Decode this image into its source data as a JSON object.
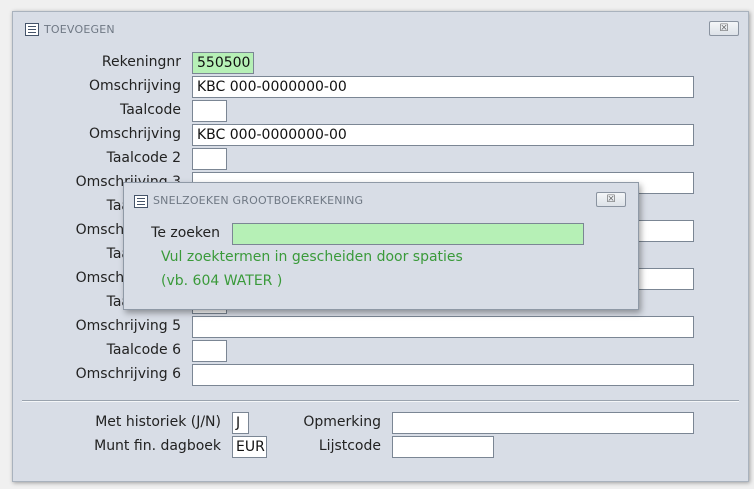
{
  "main_window": {
    "title": "TOEVOEGEN",
    "close_label": "☒",
    "fields": {
      "rekeningnr": {
        "label": "Rekeningnr",
        "value": "550500"
      },
      "omschrijving1": {
        "label": "Omschrijving",
        "value": "KBC 000-0000000-00"
      },
      "taalcode1": {
        "label": "Taalcode",
        "value": ""
      },
      "omschrijving2": {
        "label": "Omschrijving",
        "value": "KBC 000-0000000-00"
      },
      "taalcode2": {
        "label": "Taalcode 2",
        "value": ""
      },
      "omschrijving3": {
        "label": "Omschrijving 3",
        "value": ""
      },
      "taalcode3": {
        "label": "Taalcode 3",
        "value": ""
      },
      "omschrijving4": {
        "label": "Omschrijving 4",
        "value": ""
      },
      "taalcode4": {
        "label": "Taalcode 4",
        "value": ""
      },
      "omschrijving4b": {
        "label": "Omschrijving 4",
        "value": ""
      },
      "taalcode5": {
        "label": "Taalcode 5",
        "value": ""
      },
      "omschrijving5": {
        "label": "Omschrijving 5",
        "value": ""
      },
      "taalcode6": {
        "label": "Taalcode 6",
        "value": ""
      },
      "omschrijving6": {
        "label": "Omschrijving 6",
        "value": ""
      },
      "met_historiek": {
        "label": "Met historiek (J/N)",
        "value": "J"
      },
      "munt": {
        "label": "Munt fin. dagboek",
        "value": "EUR"
      },
      "opmerking": {
        "label": "Opmerking",
        "value": ""
      },
      "lijstcode": {
        "label": "Lijstcode",
        "value": ""
      }
    }
  },
  "dialog": {
    "title": "SNELZOEKEN GROOTBOEKREKENING",
    "close_label": "☒",
    "search_label": "Te zoeken",
    "search_value": "",
    "hint_line1": "Vul zoektermen in gescheiden door spaties",
    "hint_line2": "(vb.  604  WATER )"
  },
  "colors": {
    "window_bg": "#d8dde6",
    "highlight_field": "#b6f0b6",
    "hint_text": "#3a9a3a"
  }
}
